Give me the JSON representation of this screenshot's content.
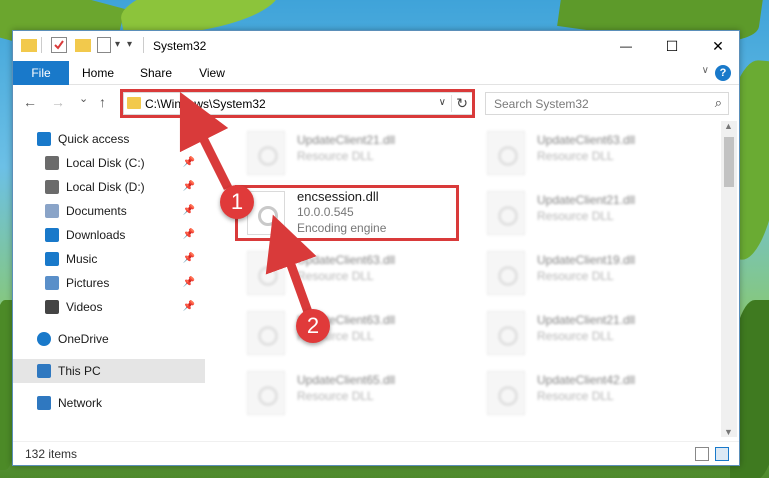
{
  "window": {
    "title": "System32",
    "dropdown_glyph": "▾",
    "minimize_glyph": "—",
    "maximize_glyph": "☐",
    "close_glyph": "✕"
  },
  "ribbon": {
    "tabs": [
      "File",
      "Home",
      "Share",
      "View"
    ],
    "expand_glyph": "∨",
    "help_glyph": "?"
  },
  "nav": {
    "back_glyph": "←",
    "forward_glyph": "→",
    "recent_glyph": "⌄",
    "up_glyph": "↑"
  },
  "address": {
    "path": "C:\\Windows\\System32",
    "dropdown_glyph": "∨",
    "refresh_glyph": "↻"
  },
  "search": {
    "placeholder": "Search System32",
    "icon_glyph": "⌕"
  },
  "sidebar": {
    "pin_glyph": "📌",
    "items": [
      {
        "label": "Quick access",
        "icon": "star-icon",
        "pinned": false
      },
      {
        "label": "Local Disk (C:)",
        "icon": "drive-icon",
        "pinned": true
      },
      {
        "label": "Local Disk (D:)",
        "icon": "drive-icon",
        "pinned": true
      },
      {
        "label": "Documents",
        "icon": "documents-icon",
        "pinned": true
      },
      {
        "label": "Downloads",
        "icon": "downloads-icon",
        "pinned": true
      },
      {
        "label": "Music",
        "icon": "music-icon",
        "pinned": true
      },
      {
        "label": "Pictures",
        "icon": "pictures-icon",
        "pinned": true
      },
      {
        "label": "Videos",
        "icon": "videos-icon",
        "pinned": true
      },
      {
        "label": "OneDrive",
        "icon": "cloud-icon",
        "pinned": false
      },
      {
        "label": "This PC",
        "icon": "computer-icon",
        "pinned": false,
        "active": true
      },
      {
        "label": "Network",
        "icon": "network-icon",
        "pinned": false
      }
    ]
  },
  "files": {
    "selected": {
      "name": "encsession.dll",
      "version": "10.0.0.545",
      "description": "Encoding engine"
    },
    "left_column": [
      {
        "name": "UpdateClient21.dll",
        "type": "Resource DLL"
      },
      {
        "name": "UpdateClient63.dll",
        "type": "Resource DLL"
      },
      {
        "name": "UpdateClient63.dll",
        "type": "Resource DLL"
      },
      {
        "name": "UpdateClient65.dll",
        "type": "Resource DLL"
      }
    ],
    "right_column": [
      {
        "name": "UpdateClient63.dll",
        "type": "Resource DLL"
      },
      {
        "name": "UpdateClient21.dll",
        "type": "Resource DLL"
      },
      {
        "name": "UpdateClient19.dll",
        "type": "Resource DLL"
      },
      {
        "name": "UpdateClient21.dll",
        "type": "Resource DLL"
      },
      {
        "name": "UpdateClient42.dll",
        "type": "Resource DLL"
      }
    ]
  },
  "status": {
    "count": "132 items"
  },
  "scrollbar": {
    "up_glyph": "▲",
    "down_glyph": "▼"
  },
  "annotations": {
    "badge1": "1",
    "badge2": "2",
    "color": "#d93a3a"
  },
  "colors": {
    "accent": "#1979ca",
    "highlight": "#d93a3a",
    "active_row": "#e5e5e5"
  }
}
